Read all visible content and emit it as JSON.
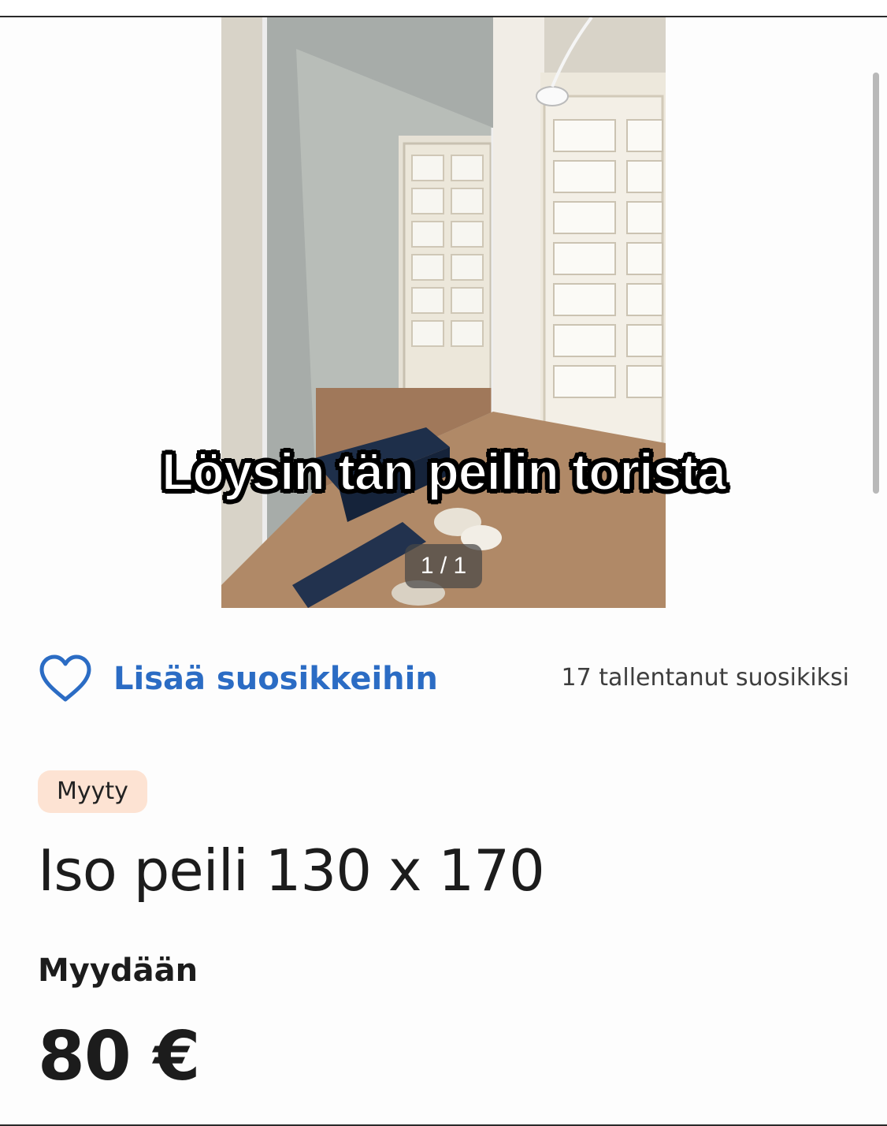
{
  "photo": {
    "caption": "Löysin tän peilin torista",
    "counter": "1 / 1"
  },
  "favorites": {
    "button_label": "Lisää suosikkeihin",
    "count_text": "17 tallentanut suosikiksi",
    "icon": "heart-outline-icon",
    "accent_color": "#2b6cc4"
  },
  "listing": {
    "status": "Myyty",
    "status_color": "#fde3d3",
    "title": "Iso peili 130 x 170",
    "sale_type": "Myydään",
    "price": "80 €"
  }
}
